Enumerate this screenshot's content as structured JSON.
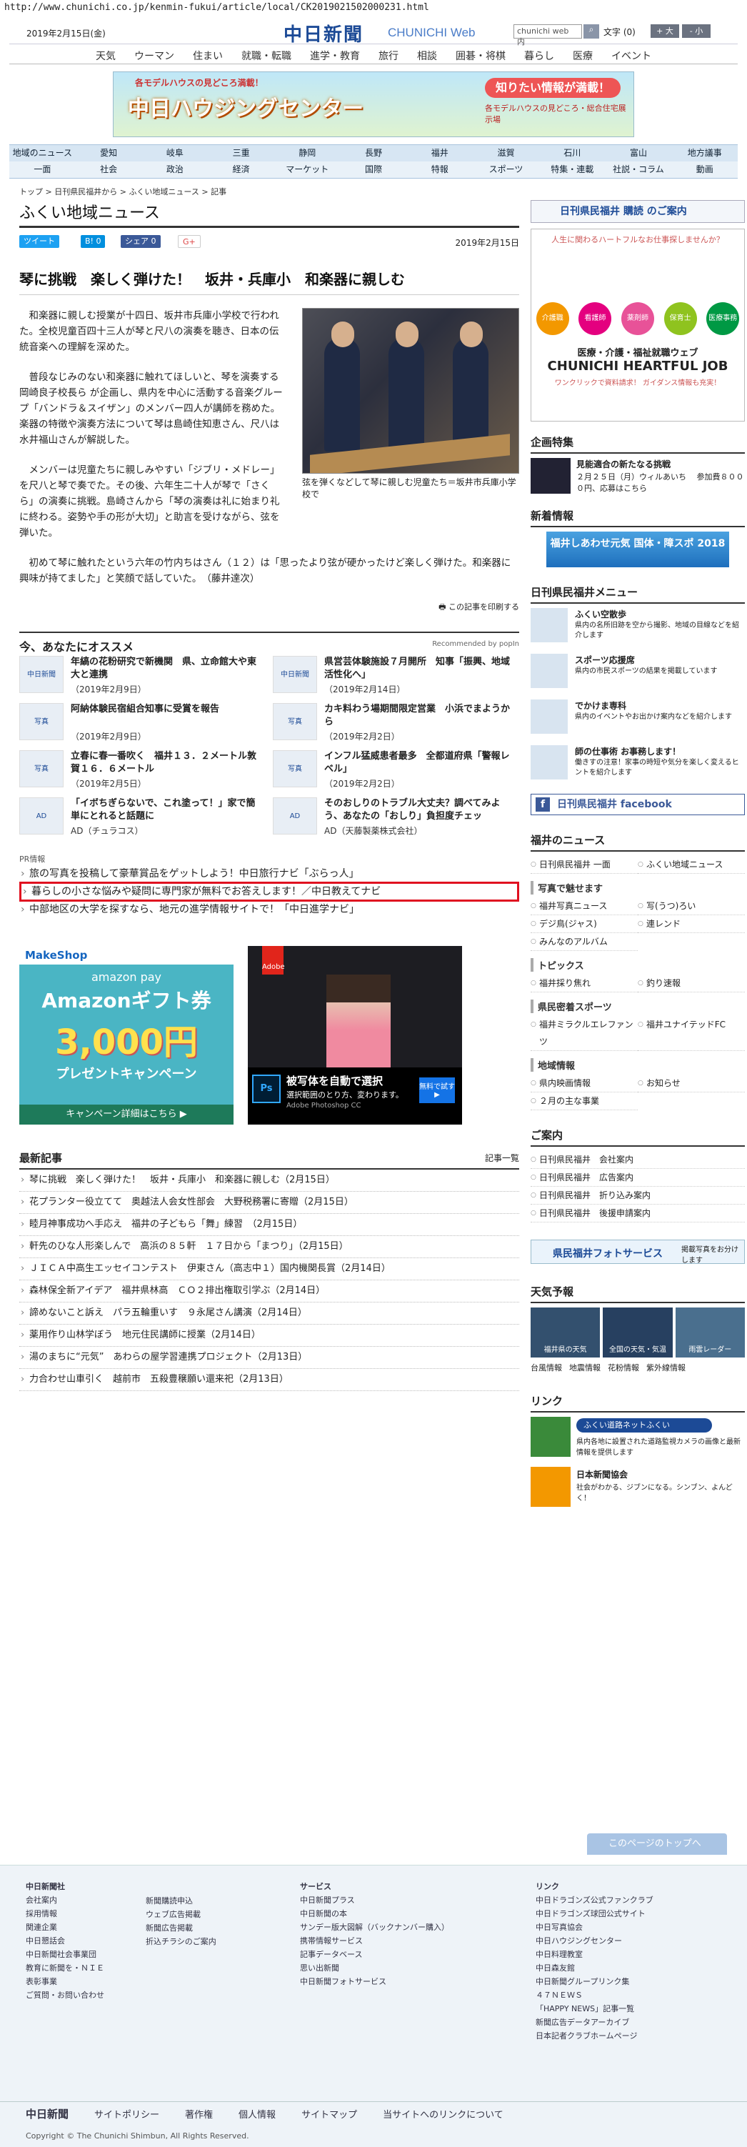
{
  "url": "http://www.chunichi.co.jp/kenmin-fukui/article/local/CK2019021502000231.html",
  "header": {
    "date": "2019年2月15日(金)",
    "logo": "中日新聞",
    "logo_en": "CHUNICHI Web",
    "search_placeholder": "chunichi web 内",
    "search_btn": "検索",
    "font_label": "文字 (0)",
    "font_plus": "+ 大",
    "font_minus": "- 小"
  },
  "categories": [
    "天気",
    "ウーマン",
    "住まい",
    "就職・転職",
    "進学・教育",
    "旅行",
    "相談",
    "囲碁・将棋",
    "暮らし",
    "医療",
    "イベント"
  ],
  "ad_top": {
    "t1": "各モデルハウスの見どころ満載！",
    "t2": "中日ハウジングセンター",
    "t3": "知りたい情報が満載！",
    "t4": "各モデルハウスの見どころ・総合住宅展示場"
  },
  "nav_regions": [
    "地域のニュース",
    "愛知",
    "岐阜",
    "三重",
    "静岡",
    "長野",
    "福井",
    "滋賀",
    "石川",
    "富山",
    "地方議事"
  ],
  "nav_topics": [
    "一面",
    "社会",
    "政治",
    "経済",
    "マーケット",
    "国際",
    "特報",
    "スポーツ",
    "特集・連載",
    "社説・コラム",
    "動画"
  ],
  "breadcrumb": "トップ > 日刊県民福井から > ふくい地域ニュース > 記事",
  "section_title": "ふくい地域ニュース",
  "share": {
    "tweet": "ツイート",
    "hatena": "B! 0",
    "fb": "シェア 0",
    "g": "G+"
  },
  "article": {
    "date": "2019年2月15日",
    "title": "琴に挑戦　楽しく弾けた！　坂井・兵庫小　和楽器に親しむ",
    "p1": "和楽器に親しむ授業が十四日、坂井市兵庫小学校で行われた。全校児童百四十三人が琴と尺八の演奏を聴き、日本の伝統音楽への理解を深めた。",
    "p2": "普段なじみのない和楽器に触れてほしいと、琴を演奏する岡崎良子校長ら が企画し、県内を中心に活動する音楽グループ「バンドラ＆スイザン」のメンバー四人が講師を務めた。楽器の特徴や演奏方法について琴は島崎住知恵さん、尺八は水井福山さんが解説した。",
    "p3": "メンバーは児童たちに親しみやすい「ジブリ・メドレー」を尺八と琴で奏でた。その後、六年生二十人が琴で「さくら」の演奏に挑戦。島崎さんから「琴の演奏は礼に始まり礼に終わる。姿勢や手の形が大切」と助言を受けながら、弦を弾いた。",
    "p4": "初めて琴に触れたという六年の竹内ちはさん（１２）は「思ったより弦が硬かったけど楽しく弾けた。和楽器に興味が持てました」と笑顔で話していた。　（藤井達次）",
    "caption": "弦を弾くなどして琴に親しむ児童たち＝坂井市兵庫小学校で",
    "print": "この記事を印刷する"
  },
  "recommend": {
    "title": "今、あなたにオススメ",
    "powered": "Recommended by popIn",
    "items": [
      {
        "thumb": "中日新聞",
        "title": "年縞の花粉研究で新機関　県、立命館大や東大と連携",
        "date": "（2019年2月9日）"
      },
      {
        "thumb": "中日新聞",
        "title": "県営芸体験施設７月開所　知事「振興、地域活性化へ」",
        "date": "（2019年2月14日）"
      },
      {
        "thumb": "写真",
        "title": "阿納体験民宿組合知事に受賞を報告",
        "date": "（2019年2月9日）"
      },
      {
        "thumb": "写真",
        "title": "カキ料わう場期間限定営業　小浜でまようから",
        "date": "（2019年2月2日）"
      },
      {
        "thumb": "写真",
        "title": "立春に春一番吹く　福井１３．２メートル敦賀１６．６メートル",
        "date": "（2019年2月5日）"
      },
      {
        "thumb": "写真",
        "title": "インフル猛威患者最多　全都道府県「警報レベル」",
        "date": "（2019年2月2日）"
      },
      {
        "thumb": "AD",
        "title": "「イボちぎらないで、これ塗って！」家で簡単にとれると話題に",
        "date": "AD（チュラコス）"
      },
      {
        "thumb": "AD",
        "title": "そのおしりのトラブル大丈夫？調べてみよう、あなたの「おしり」負担度チェッ",
        "date": "AD（天藤製薬株式会社）"
      }
    ]
  },
  "pr": {
    "label": "PR情報",
    "items": [
      "旅の写真を投稿して豪華賞品をゲットしよう！中日旅行ナビ「ぶらっ人」",
      "暮らしの小さな悩みや疑問に専門家が無料でお答えします！／中日教えてナビ",
      "中部地区の大学を探すなら、地元の進学情報サイトで！「中日進学ナビ」"
    ]
  },
  "ad_left": {
    "brand": "MakeShop",
    "sub": "amazon pay",
    "big": "Amazonギフト券",
    "amount": "3,000円",
    "present": "プレゼントキャンペーン",
    "cta": "キャンペーン詳細はこちら ▶"
  },
  "ad_right": {
    "brand": "Adobe",
    "line1": "被写体を自動で選択",
    "line2": "選択範囲のとり方、変わります。",
    "product": "Adobe Photoshop CC",
    "cta": "無料で試す ▶"
  },
  "latest": {
    "title": "最新記事",
    "more": "記事一覧",
    "items": [
      "琴に挑戦　楽しく弾けた！　坂井・兵庫小　和楽器に親しむ（2月15日）",
      "花プランター役立てて　奥越法人会女性部会　大野税務署に寄贈（2月15日）",
      "睦月神事成功へ手応え　福井の子どもら「舞」練習　（2月15日）",
      "軒先のひな人形楽しんで　高浜の８５軒　１７日から「まつり」（2月15日）",
      "ＪＩＣＡ中高生エッセイコンテスト　伊東さん（高志中１）国内機関長賞（2月14日）",
      "森林保全新アイデア　福井県林高　ＣＯ２排出権取引学ぶ（2月14日）",
      "諦めないこと訴え　パラ五輪重いす　９永尾さん講演（2月14日）",
      "薬用作り山林学ぼう　地元住民講師に授業（2月14日）",
      "湯のまちに“元気”　あわらの屋学習連携プロジェクト（2月13日）",
      "力合わせ山車引く　越前市　五殺豊穣願い還来祀（2月13日）"
    ]
  },
  "side": {
    "subscribe": "日刊県民福井 購読 のご案内",
    "job": {
      "top": "人生に関わるハートフルなお仕事探しませんか？",
      "cats": [
        "介護職",
        "看護師",
        "薬剤師",
        "保育士",
        "医療事務"
      ],
      "title": "医療・介護・福祉就職ウェブ",
      "brand": "CHUNICHI HEARTFUL JOB",
      "foot": "ワンクリックで資料請求！ ガイダンス情報も充実！"
    },
    "special": {
      "title": "企画特集",
      "item": "見能適合の新たなる挑戦",
      "desc": "２月２５日（月）ウィルあいち 　参加費８０００円、応募はこちら"
    },
    "new": {
      "title": "新着情報",
      "banner": "福井しあわせ元気 国体・障スポ 2018"
    },
    "menu": {
      "title": "日刊県民福井メニュー",
      "items": [
        {
          "t": "ふくい空散歩",
          "d": "県内の名所旧跡を空から撮影、地域の目線などを紹介します"
        },
        {
          "t": "スポーツ応援席",
          "d": "県内の市民スポーツの結果を掲載しています"
        },
        {
          "t": "でかけま専科",
          "d": "県内のイベントやお出かけ案内などを紹介します"
        },
        {
          "t": "師の仕事術 お事務します！",
          "d": "働きすの注意！家事の時短や気分を楽しく変えるヒントを紹介します"
        }
      ]
    },
    "fb": "日刊県民福井 facebook",
    "news": {
      "title": "福井のニュース",
      "top": [
        "日刊県民福井 一面",
        "ふくい地域ニュース"
      ],
      "photo_t": "写真で魅せます",
      "photo": [
        "福井写真ニュース",
        "写(うつ)ろい",
        "デジ鳥(ジャス)",
        "連レンド",
        "みんなのアルバム"
      ],
      "topics_t": "トピックス",
      "topics": [
        "福井採り焦れ",
        "釣り速報"
      ],
      "sports_t": "県民密着スポーツ",
      "sports": [
        "福井ミラクルエレファンツ",
        "福井ユナイテッドFC"
      ],
      "local_t": "地域情報",
      "local": [
        "県内映画情報",
        "お知らせ",
        "２月の主な事業"
      ]
    },
    "guide": {
      "title": "ご案内",
      "items": [
        "日刊県民福井　会社案内",
        "日刊県民福井　広告案内",
        "日刊県民福井　折り込み案内",
        "日刊県民福井　後援申請案内"
      ]
    },
    "photo_service": "県民福井フォトサービス",
    "photo_service2": "掲載写真をお分けします",
    "weather": {
      "title": "天気予報",
      "tiles": [
        "福井県の天気",
        "全国の天気・気温",
        "雨雲レーダー"
      ],
      "links": [
        "台風情報",
        "地震情報",
        "花粉情報",
        "紫外線情報"
      ]
    },
    "link": {
      "title": "リンク",
      "l1": "ふくい道路ネットふくい",
      "d1": "県内各地に設置された道路監視カメラの画像と最新情報を提供します",
      "l2": "日本新聞協会",
      "d2": "社会がわかる、ジブンになる。シンブン、よんどく！"
    },
    "totop": "このページのトップへ"
  },
  "footer": {
    "c1_title": "中日新聞社",
    "c1": [
      "会社案内",
      "採用情報",
      "関連企業",
      "中日懇話会",
      "中日新聞社会事業団",
      "教育に新聞を・ＮＩＥ",
      "表彰事業",
      "ご質問・お問い合わせ"
    ],
    "c2": [
      "新聞購読申込",
      "ウェブ広告掲載",
      "新聞広告掲載",
      "折込チラシのご案内"
    ],
    "c3_title": "サービス",
    "c3": [
      "中日新聞プラス",
      "中日新聞の本",
      "サンデー版大図解（バックナンバー購入）",
      "携帯情報サービス",
      "記事データベース",
      "思い出新聞",
      "中日新聞フォトサービス"
    ],
    "c4_title": "リンク",
    "c4": [
      "中日ドラゴンズ公式ファンクラブ",
      "中日ドラゴンズ球団公式サイト",
      "中日写真協会",
      "中日ハウジングセンター",
      "中日料理教室",
      "中日森友館",
      "中日新聞グループリンク集",
      "４７ＮＥＷＳ",
      "「HAPPY NEWS」記事一覧",
      "新聞広告データアーカイブ",
      "日本記者クラブホームページ"
    ],
    "bar": [
      "中日新聞",
      "サイトポリシー",
      "著作権",
      "個人情報",
      "サイトマップ",
      "当サイトへのリンクについて"
    ],
    "copy": "Copyright © The Chunichi Shimbun, All Rights Reserved."
  },
  "colors": {
    "brand": "#1c4a96",
    "highlight": "#e01020",
    "fb": "#3b5998"
  }
}
